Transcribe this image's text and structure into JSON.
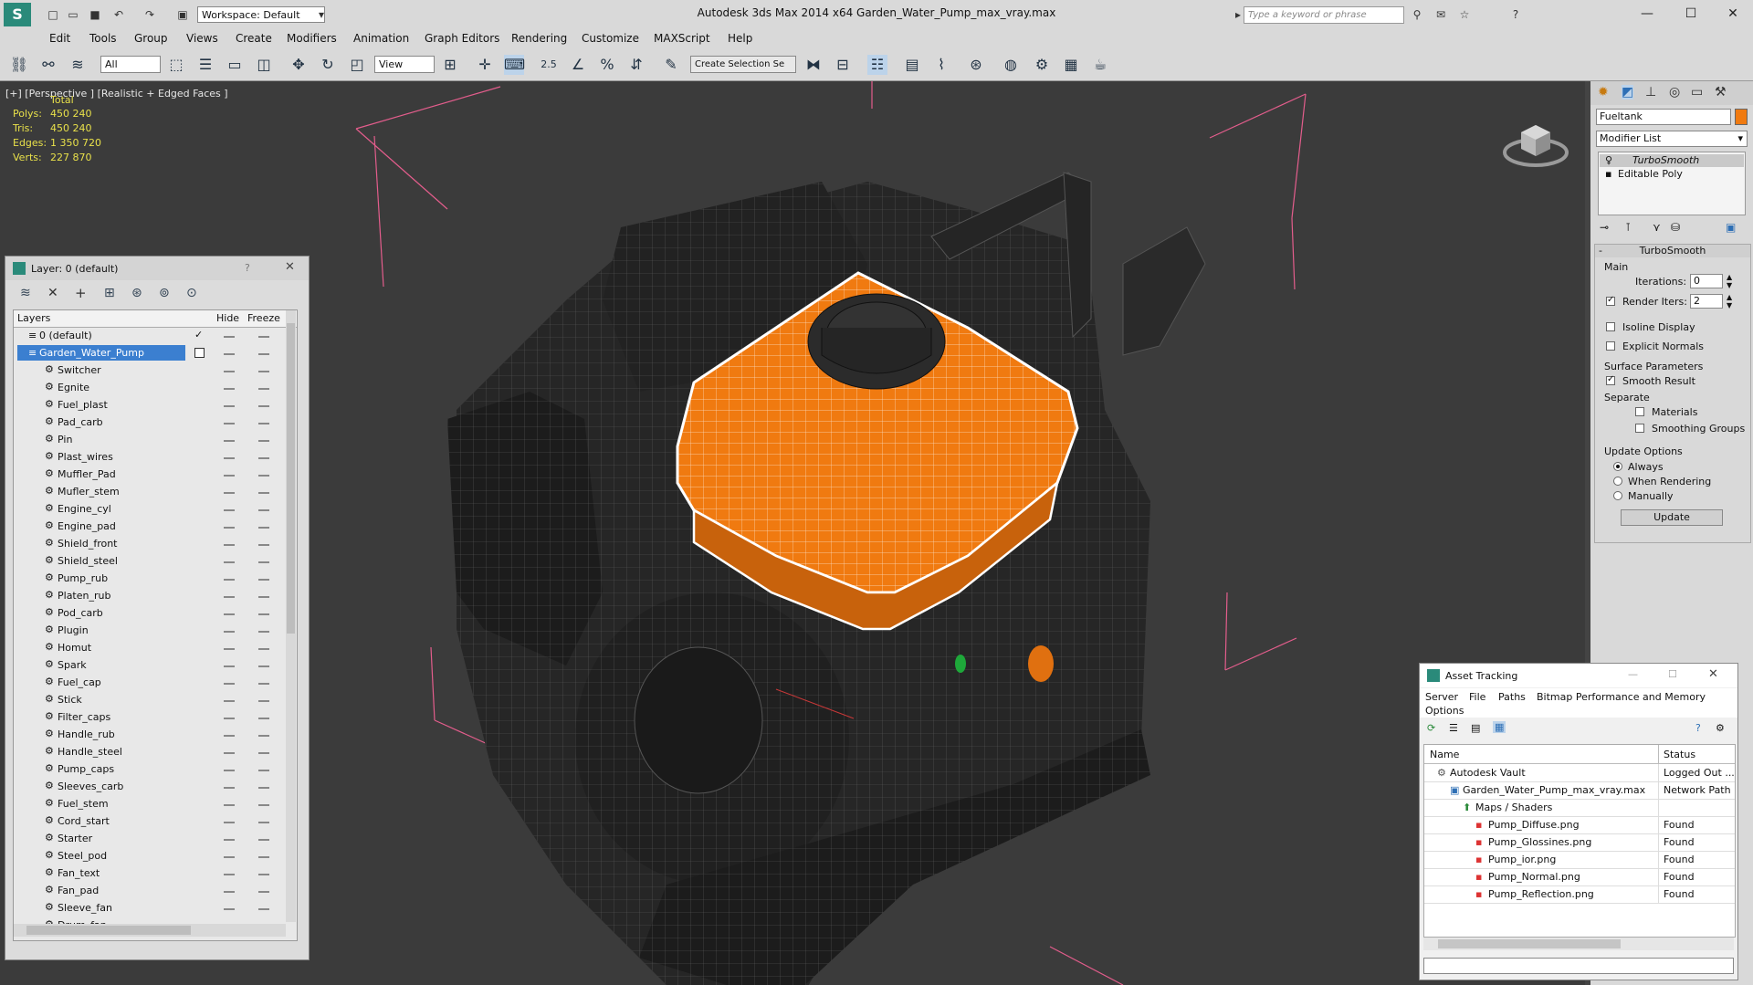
{
  "app": {
    "title": "Autodesk 3ds Max  2014 x64      Garden_Water_Pump_max_vray.max",
    "workspace": "Workspace: Default",
    "search_placeholder": "Type a keyword or phrase"
  },
  "menu": [
    "Edit",
    "Tools",
    "Group",
    "Views",
    "Create",
    "Modifiers",
    "Animation",
    "Graph Editors",
    "Rendering",
    "Customize",
    "MAXScript",
    "Help"
  ],
  "toolbar": {
    "selection_filter": "All",
    "ref_coord": "View",
    "selection_set": "Create Selection Se",
    "snap_label": "2.5"
  },
  "viewport": {
    "label": "[+] [Perspective ] [Realistic + Edged Faces ]",
    "stats": {
      "header": "Total",
      "rows": [
        {
          "k": "Polys:",
          "v": "450 240"
        },
        {
          "k": "Tris:",
          "v": "450 240"
        },
        {
          "k": "Edges:",
          "v": "1 350 720"
        },
        {
          "k": "Verts:",
          "v": "227 870"
        }
      ]
    }
  },
  "layer_panel": {
    "title": "Layer: 0 (default)",
    "help": "?",
    "columns": {
      "layers": "Layers",
      "hide": "Hide",
      "freeze": "Freeze"
    },
    "root": "0 (default)",
    "group": "Garden_Water_Pump",
    "items": [
      "Switcher",
      "Egnite",
      "Fuel_plast",
      "Pad_carb",
      "Pin",
      "Plast_wires",
      "Muffler_Pad",
      "Mufler_stem",
      "Engine_cyl",
      "Engine_pad",
      "Shield_front",
      "Shield_steel",
      "Pump_rub",
      "Platen_rub",
      "Pod_carb",
      "Plugin",
      "Homut",
      "Spark",
      "Fuel_cap",
      "Stick",
      "Filter_caps",
      "Handle_rub",
      "Handle_steel",
      "Pump_caps",
      "Sleeves_carb",
      "Fuel_stem",
      "Cord_start",
      "Starter",
      "Steel_pod",
      "Fan_text",
      "Fan_pad",
      "Sleeve_fan",
      "Drum_fan"
    ]
  },
  "command_panel": {
    "object_name": "Fueltank",
    "modifier_list": "Modifier List",
    "stack": [
      "TurboSmooth",
      "Editable Poly"
    ],
    "rollout": "TurboSmooth",
    "main": "Main",
    "iterations_label": "Iterations:",
    "iterations": "0",
    "render_iters_label": "Render Iters:",
    "render_iters": "2",
    "isoline": "Isoline Display",
    "explicit": "Explicit Normals",
    "surface": "Surface Parameters",
    "smooth_result": "Smooth Result",
    "separate": "Separate",
    "materials": "Materials",
    "smoothing_groups": "Smoothing Groups",
    "update_options": "Update Options",
    "always": "Always",
    "when_rendering": "When Rendering",
    "manually": "Manually",
    "update": "Update"
  },
  "asset_tracking": {
    "title": "Asset Tracking",
    "menu": [
      "Server",
      "File",
      "Paths",
      "Bitmap Performance and Memory"
    ],
    "menu2": "Options",
    "col_name": "Name",
    "col_status": "Status",
    "rows": [
      {
        "name": "Autodesk Vault",
        "status": "Logged Out ..."
      },
      {
        "name": "Garden_Water_Pump_max_vray.max",
        "status": "Network Path"
      },
      {
        "name": "Maps / Shaders",
        "status": ""
      },
      {
        "name": "Pump_Diffuse.png",
        "status": "Found"
      },
      {
        "name": "Pump_Glossines.png",
        "status": "Found"
      },
      {
        "name": "Pump_ior.png",
        "status": "Found"
      },
      {
        "name": "Pump_Normal.png",
        "status": "Found"
      },
      {
        "name": "Pump_Reflection.png",
        "status": "Found"
      }
    ]
  },
  "colors": {
    "accent": "#1e7fd6",
    "orange": "#f07a10",
    "viewport": "#3b3b3b",
    "stats": "#e8e04a"
  }
}
